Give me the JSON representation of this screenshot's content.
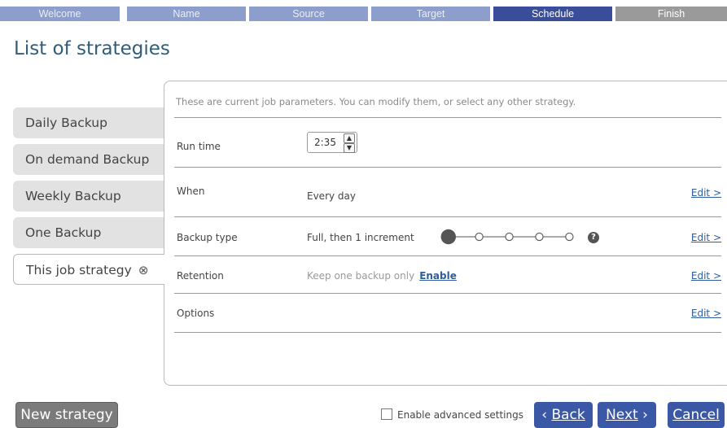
{
  "wizard_steps": [
    {
      "label": "Welcome",
      "state": "done"
    },
    {
      "label": "Name",
      "state": "done"
    },
    {
      "label": "Source",
      "state": "done"
    },
    {
      "label": "Target",
      "state": "done"
    },
    {
      "label": "Schedule",
      "state": "active"
    },
    {
      "label": "Finish",
      "state": "future"
    }
  ],
  "page_title": "List of strategies",
  "strategies": [
    {
      "label": "Daily Backup"
    },
    {
      "label": "On demand Backup"
    },
    {
      "label": "Weekly Backup"
    },
    {
      "label": "One Backup"
    },
    {
      "label": "This job strategy",
      "selected": true,
      "remove_icon": "⊗"
    }
  ],
  "panel": {
    "intro": "These are current job parameters. You can modify them, or select any other strategy.",
    "run_time": {
      "label": "Run time",
      "value": "2:35"
    },
    "when": {
      "label": "When",
      "value": "Every day",
      "edit": "Edit >"
    },
    "backup_type": {
      "label": "Backup type",
      "value": "Full, then 1 increment",
      "slider_steps": 6,
      "slider_selected": 1,
      "help_icon": "?",
      "edit": "Edit >"
    },
    "retention": {
      "label": "Retention",
      "value": "Keep one backup only",
      "enable": "Enable",
      "edit": "Edit >"
    },
    "options": {
      "label": "Options",
      "edit": "Edit >"
    }
  },
  "footer": {
    "new_strategy": "New strategy",
    "advanced_settings": "Enable advanced settings",
    "advanced_checked": false,
    "back": "Back",
    "back_arrow": "‹",
    "next": "Next",
    "next_arrow": "›",
    "cancel": "Cancel"
  },
  "colors": {
    "step_done": "#8d9dcc",
    "step_active": "#3a4d9b",
    "step_future": "#9a9a9a",
    "accent_button": "#3b58a6",
    "title": "#2f5d7a",
    "link": "#2e5d9e"
  }
}
